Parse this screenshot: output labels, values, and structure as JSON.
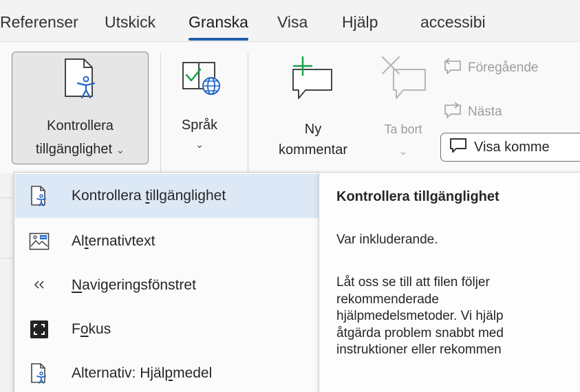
{
  "tabs": [
    {
      "label": "Referenser",
      "active": false
    },
    {
      "label": "Utskick",
      "active": false
    },
    {
      "label": "Granska",
      "active": true
    },
    {
      "label": "Visa",
      "active": false
    },
    {
      "label": "Hjälp",
      "active": false
    },
    {
      "label": "accessibi",
      "active": false
    }
  ],
  "ribbon": {
    "check_accessibility": {
      "line1": "Kontrollera",
      "line2": "tillgänglighet",
      "chevron": "⌄"
    },
    "language": {
      "label": "Språk",
      "chevron": "⌄"
    },
    "new_comment": {
      "line1": "Ny",
      "line2": "kommentar"
    },
    "delete": {
      "label": "Ta bort",
      "chevron": "⌄"
    },
    "previous": {
      "label": "Föregående"
    },
    "next": {
      "label": "Nästa"
    },
    "show_comments": {
      "label": "Visa komme"
    }
  },
  "menu": {
    "items": [
      {
        "pre": "Kontrollera ",
        "key": "t",
        "post": "illgänglighet",
        "icon": "accessibility-checker-icon"
      },
      {
        "pre": "Al",
        "key": "t",
        "post": "ernativtext",
        "icon": "alt-text-icon"
      },
      {
        "pre": "",
        "key": "N",
        "post": "avigeringsfönstret",
        "icon": "navigation-pane-icon"
      },
      {
        "pre": "F",
        "key": "o",
        "post": "kus",
        "icon": "focus-icon"
      },
      {
        "pre": "Alternativ: Hjäl",
        "key": "p",
        "post": "medel",
        "icon": "accessibility-options-icon"
      }
    ]
  },
  "tooltip": {
    "title": "Kontrollera tillgänglighet",
    "subtitle": "Var inkluderande.",
    "body_lines": [
      "Låt oss se till att filen följer",
      "rekommenderade",
      "hjälpmedelsmetoder. Vi hjälp",
      "åtgärda problem snabbt med",
      "instruktioner eller rekommen"
    ]
  },
  "colors": {
    "accent": "#1f5fa8",
    "menu_hover": "#dde8f6",
    "accessibility_blue": "#1e64c8",
    "comment_green": "#17a04a"
  }
}
